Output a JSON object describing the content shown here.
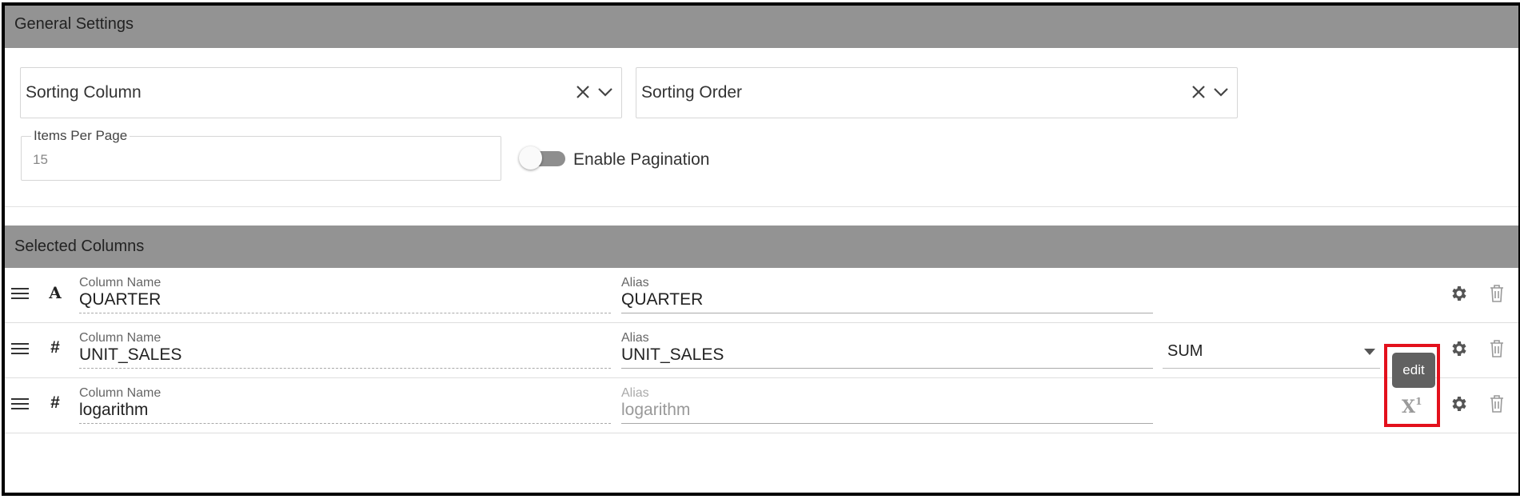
{
  "general_settings": {
    "title": "General Settings",
    "sorting_column": {
      "value": "Sorting Column"
    },
    "sorting_order": {
      "value": "Sorting Order"
    },
    "items_per_page": {
      "label": "Items Per Page",
      "value": "15"
    },
    "pagination": {
      "label": "Enable Pagination",
      "enabled": false
    }
  },
  "selected_columns": {
    "title": "Selected Columns",
    "rows": [
      {
        "type_icon": "A",
        "column_name_label": "Column Name",
        "column_name": "QUARTER",
        "alias_label": "Alias",
        "alias": "QUARTER"
      },
      {
        "type_icon": "#",
        "column_name_label": "Column Name",
        "column_name": "UNIT_SALES",
        "alias_label": "Alias",
        "alias": "UNIT_SALES",
        "aggregation": "SUM"
      },
      {
        "type_icon": "#",
        "column_name_label": "Column Name",
        "column_name": "logarithm",
        "alias_label": "Alias",
        "alias_placeholder": "logarithm"
      }
    ]
  },
  "tooltip": {
    "text": "edit"
  },
  "formula_icon": {
    "base": "X",
    "sup": "1"
  },
  "colors": {
    "header_bg": "#939393",
    "highlight": "#e3101c",
    "tooltip_bg": "#616161"
  }
}
